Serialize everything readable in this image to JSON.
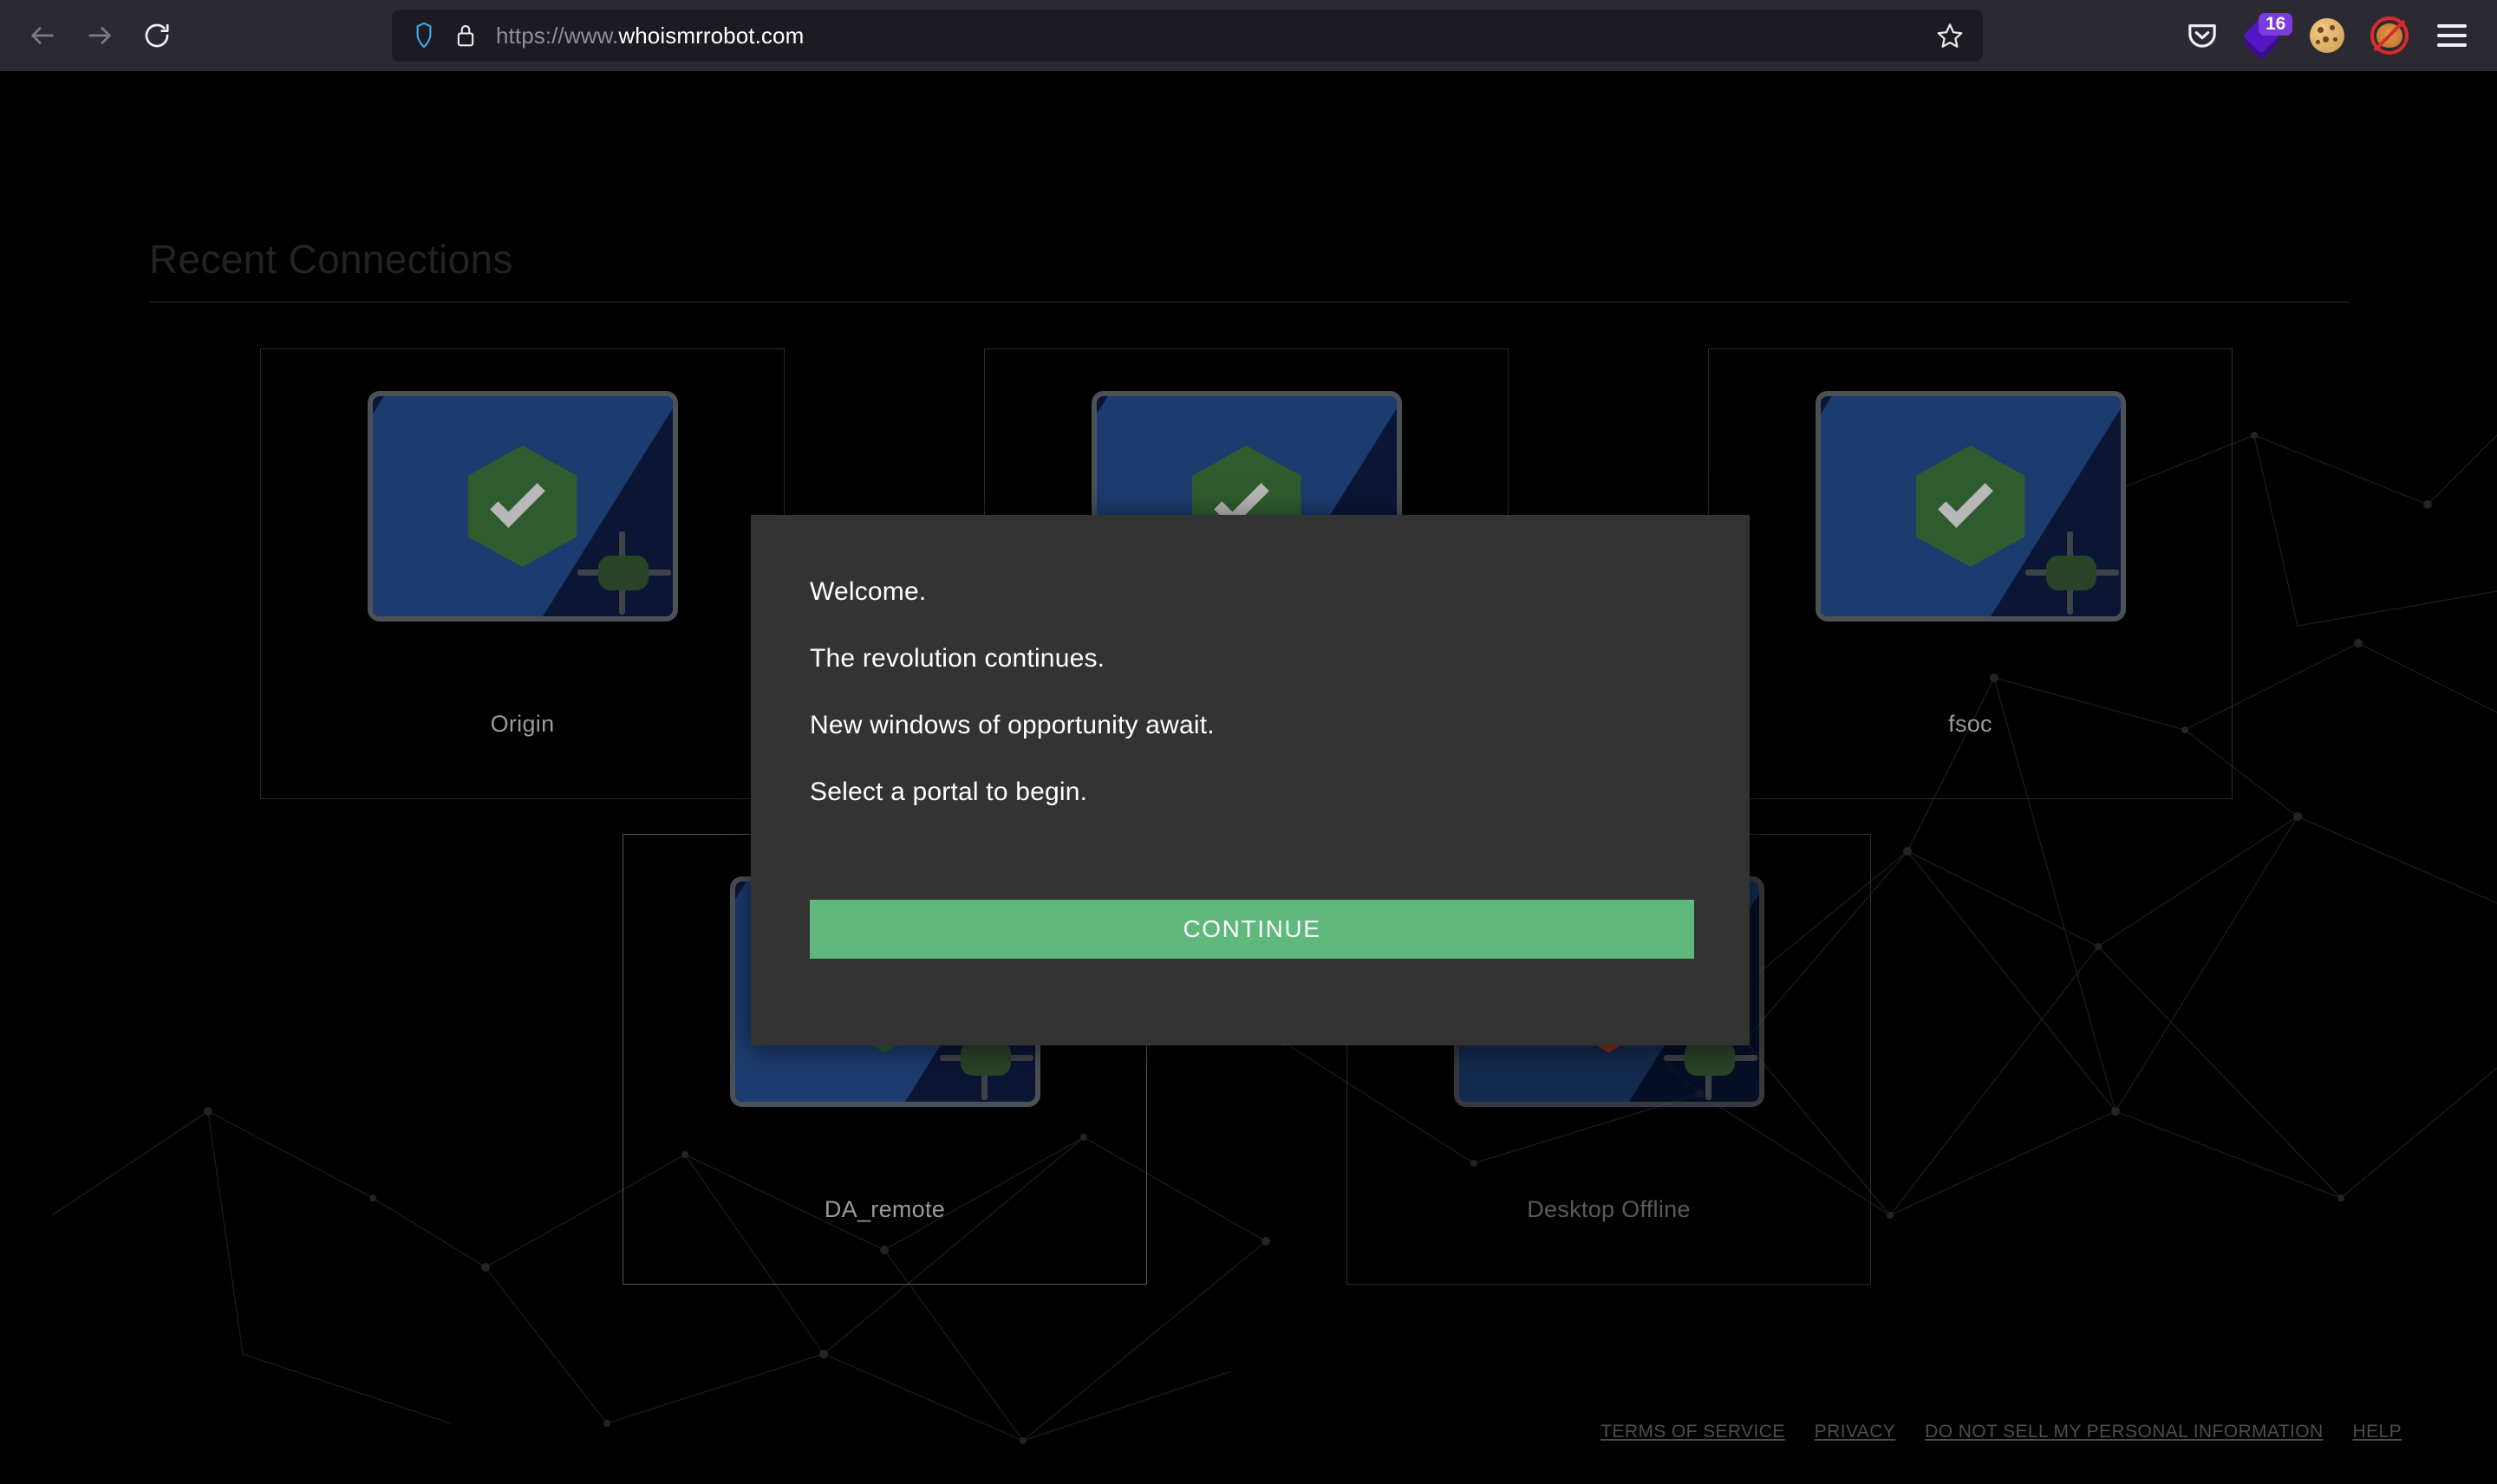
{
  "browser": {
    "back_icon": "arrow-left-icon",
    "forward_icon": "arrow-right-icon",
    "reload_icon": "reload-icon",
    "shield_icon": "shield-icon",
    "lock_icon": "lock-icon",
    "star_icon": "star-icon",
    "url_scheme": "https://www.",
    "url_domain": "whoismrrobot.com",
    "url_full": "https://www.whoismrrobot.com",
    "toolbar": {
      "pocket_icon": "pocket-icon",
      "tab_count_icon": "layers-icon",
      "tab_count": "16",
      "cookie_icon": "cookie-icon",
      "nofox_icon": "no-fox-icon",
      "menu_icon": "hamburger-menu-icon"
    }
  },
  "page": {
    "section_title": "Recent Connections",
    "cards": [
      {
        "label": "Origin",
        "status": "online",
        "selected": false
      },
      {
        "label": "",
        "status": "online",
        "selected": false
      },
      {
        "label": "fsoc",
        "status": "online",
        "selected": false
      },
      {
        "label": "DA_remote",
        "status": "online",
        "selected": true
      },
      {
        "label": "Desktop Offline",
        "status": "offline",
        "selected": false
      }
    ],
    "footer_links": [
      "TERMS OF SERVICE",
      "PRIVACY",
      "DO NOT SELL MY PERSONAL INFORMATION",
      "HELP"
    ]
  },
  "modal": {
    "line1": "Welcome.",
    "line2": "The revolution continues.",
    "line3": "New windows of opportunity await.",
    "line4": "Select a portal to begin.",
    "continue_label": "CONTINUE"
  },
  "colors": {
    "accent_green": "#5fb87c",
    "modal_bg": "#333333",
    "chrome_bg": "#2b2a33",
    "urlbar_bg": "#1c1b22",
    "screen_navy": "#0b1635",
    "screen_blue": "#1c3c70",
    "hex_online": "#2f5c2e",
    "hex_offline": "#8a2a16",
    "badge_purple": "#7a3ce0"
  }
}
